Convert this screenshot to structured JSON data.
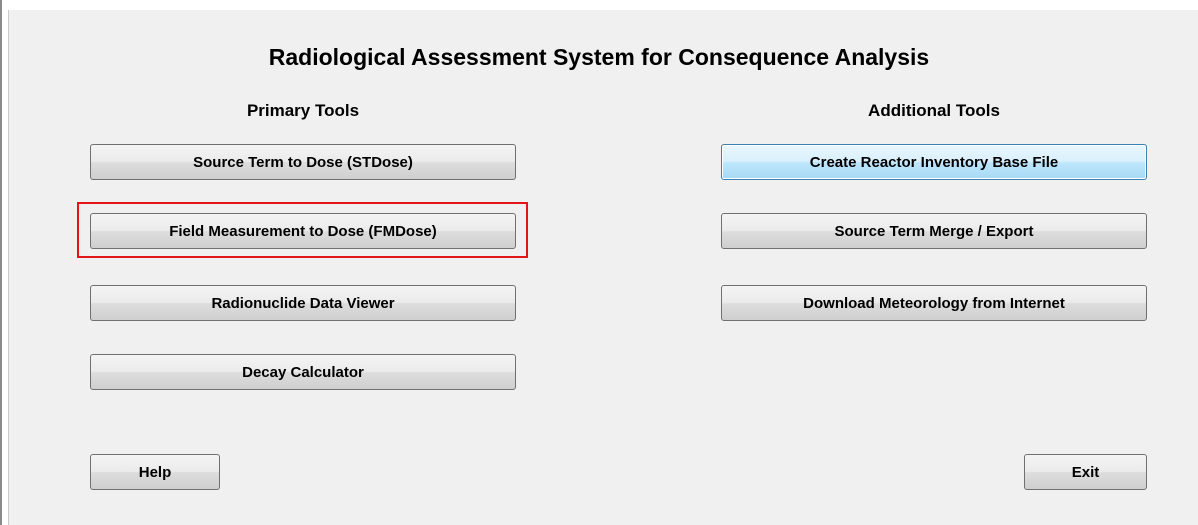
{
  "window": {
    "title": "Radiological Assessment System for Consequence Analysis"
  },
  "primary_tools": {
    "heading": "Primary Tools",
    "buttons": [
      {
        "label": "Source Term to Dose (STDose)"
      },
      {
        "label": "Field Measurement to Dose (FMDose)"
      },
      {
        "label": "Radionuclide Data Viewer"
      },
      {
        "label": "Decay Calculator"
      }
    ]
  },
  "additional_tools": {
    "heading": "Additional Tools",
    "buttons": [
      {
        "label": "Create Reactor Inventory Base File"
      },
      {
        "label": "Source Term Merge / Export"
      },
      {
        "label": "Download Meteorology from Internet"
      }
    ]
  },
  "footer": {
    "help_label": "Help",
    "exit_label": "Exit"
  },
  "colors": {
    "highlight_border": "#e0161b",
    "focused_button_border": "#3c7fb1"
  }
}
